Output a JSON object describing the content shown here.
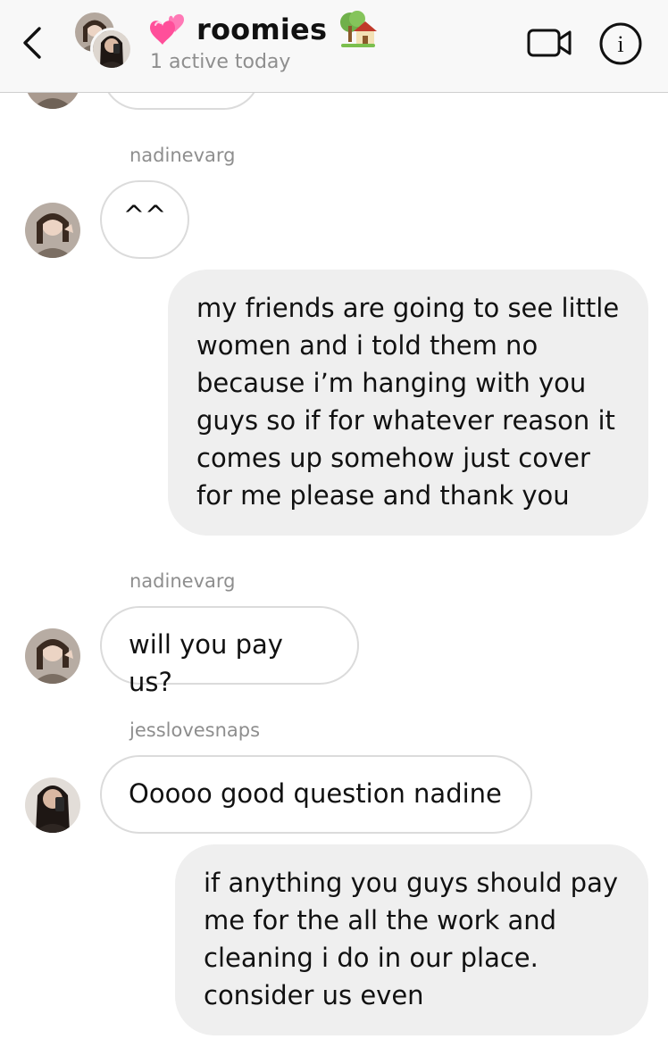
{
  "header": {
    "title": "roomies",
    "title_prefix_emoji": "heart-icon",
    "title_suffix_emoji": "house-icon",
    "subtitle": "1 active today",
    "back_icon": "chevron-left-icon",
    "video_icon": "video-camera-icon",
    "info_icon": "info-icon",
    "info_glyph": "i"
  },
  "messages": [
    {
      "kind": "incoming-partial",
      "sender": "",
      "text": ""
    },
    {
      "kind": "incoming",
      "sender": "nadinevarg",
      "text": "^^"
    },
    {
      "kind": "outgoing",
      "sender": "",
      "text": "my friends are going to see little women and i told them no because i’m hanging with you guys so if for whatever reason it comes up somehow just cover for me please and thank you"
    },
    {
      "kind": "incoming",
      "sender": "nadinevarg",
      "text": "will you pay us?"
    },
    {
      "kind": "incoming",
      "sender": "jesslovesnaps",
      "text": "Ooooo good question nadine"
    },
    {
      "kind": "outgoing",
      "sender": "",
      "text": "if anything you guys should pay me for the all the work and cleaning i do in our place. consider us even"
    }
  ],
  "colors": {
    "header_bg": "#f8f8f8",
    "outgoing_bubble": "#efefef",
    "incoming_border": "#dbdbdb",
    "secondary_text": "#8e8e8e",
    "heart": "#ff5fa2"
  }
}
